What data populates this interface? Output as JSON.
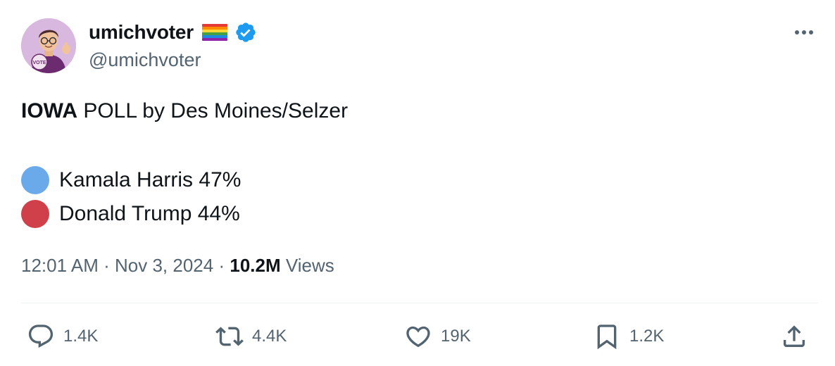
{
  "author": {
    "display_name": "umichvoter",
    "handle": "@umichvoter",
    "avatar_badge_text": "VOTE",
    "flag_icon": "rainbow-flag-icon",
    "verified_icon": "verified-badge-icon",
    "verified_color": "#1d9bf0"
  },
  "tweet": {
    "headline_bold": "IOWA",
    "headline_rest": " POLL by Des Moines/Selzer",
    "poll_rows": [
      {
        "label": "Kamala Harris 47%",
        "dot_color": "#6aa9ea",
        "icon": "blue-circle-icon"
      },
      {
        "label": "Donald Trump 44%",
        "dot_color": "#d0404a",
        "icon": "red-circle-icon"
      }
    ]
  },
  "meta": {
    "time": "12:01 AM",
    "separator": "·",
    "date": "Nov 3, 2024",
    "views_count": "10.2M",
    "views_label": "Views"
  },
  "actions": {
    "replies": {
      "count": "1.4K",
      "icon": "reply-icon"
    },
    "reposts": {
      "count": "4.4K",
      "icon": "repost-icon"
    },
    "likes": {
      "count": "19K",
      "icon": "heart-icon"
    },
    "bookmarks": {
      "count": "1.2K",
      "icon": "bookmark-icon"
    },
    "share": {
      "icon": "share-icon"
    }
  },
  "colors": {
    "text_primary": "#0f1419",
    "text_secondary": "#536471",
    "divider": "#eff3f4"
  }
}
